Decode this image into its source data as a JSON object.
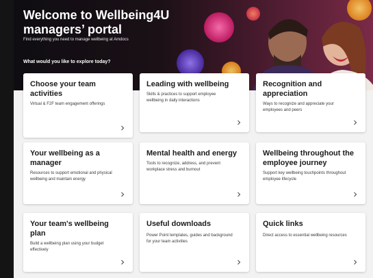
{
  "hero": {
    "title_line1": "Welcome to Wellbeing4U",
    "title_line2": "managers’ portal",
    "subtitle": "Find everything you need to manage wellbeing at Amdocs",
    "question": "What would you like to explore today?"
  },
  "cards": [
    {
      "title": "Choose your team activities",
      "description": "Virtual & F2F team engagement offerings"
    },
    {
      "title": "Leading with wellbeing",
      "description": "Skills & practices to support employee wellbeing in daily interactions"
    },
    {
      "title": "Recognition and appreciation",
      "description": "Ways to recognize and appreciate your employees and peers"
    },
    {
      "title": "Your wellbeing as a manager",
      "description": "Resources to support emotional and physical wellbeing and maintain energy"
    },
    {
      "title": "Mental health and energy",
      "description": "Tools to recognize, address, and prevent workplace stress and burnout"
    },
    {
      "title": "Wellbeing throughout the employee journey",
      "description": "Support key wellbeing touchpoints throughout employee lifecycle"
    },
    {
      "title": "Your team's wellbeing plan",
      "description": "Build a wellbeing plan using your budget effectively"
    },
    {
      "title": "Useful downloads",
      "description": "Power Point templates, guides and background for your team activities"
    },
    {
      "title": "Quick links",
      "description": "Direct access to essential wellbeing resources"
    }
  ],
  "icons": {
    "card_arrow": "chevron-right-icon"
  },
  "colors": {
    "page_bg": "#f2f2f2",
    "card_bg": "#ffffff",
    "hero_dark": "#0f0d12",
    "accent_pink": "#e0447f"
  }
}
